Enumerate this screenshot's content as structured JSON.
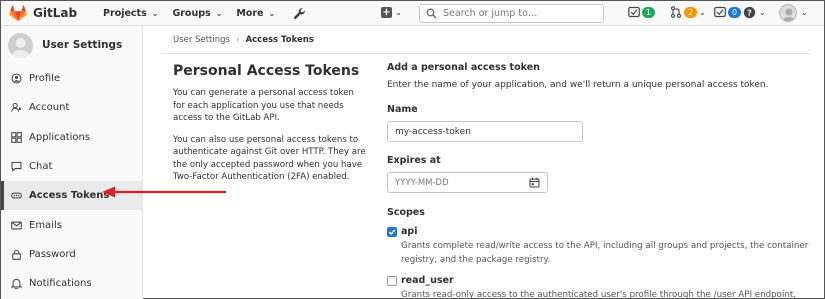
{
  "topbar": {
    "brand": "GitLab",
    "nav": [
      {
        "label": "Projects",
        "icon": "chevron-down-icon"
      },
      {
        "label": "Groups",
        "icon": "chevron-down-icon"
      },
      {
        "label": "More",
        "icon": "chevron-down-icon"
      }
    ],
    "search_placeholder": "Search or jump to…",
    "merge_requests_count": "1",
    "todos_count": "2",
    "issues_count": "0",
    "accent": "#1aaa55"
  },
  "sidebar": {
    "title": "User Settings",
    "items": [
      {
        "label": "Profile",
        "icon": "profile-icon"
      },
      {
        "label": "Account",
        "icon": "account-icon"
      },
      {
        "label": "Applications",
        "icon": "applications-icon"
      },
      {
        "label": "Chat",
        "icon": "chat-icon"
      },
      {
        "label": "Access Tokens",
        "icon": "token-icon",
        "active": true
      },
      {
        "label": "Emails",
        "icon": "email-icon"
      },
      {
        "label": "Password",
        "icon": "lock-icon"
      },
      {
        "label": "Notifications",
        "icon": "bell-icon"
      }
    ]
  },
  "breadcrumb": {
    "parent": "User Settings",
    "current": "Access Tokens"
  },
  "info": {
    "title": "Personal Access Tokens",
    "para1": "You can generate a personal access token for each application you use that needs access to the GitLab API.",
    "para2": "You can also use personal access tokens to authenticate against Git over HTTP. They are the only accepted password when you have Two-Factor Authentication (2FA) enabled."
  },
  "form": {
    "heading": "Add a personal access token",
    "hint": "Enter the name of your application, and we'll return a unique personal access token.",
    "name_label": "Name",
    "name_value": "my-access-token",
    "expires_label": "Expires at",
    "expires_placeholder": "YYYY-MM-DD",
    "scopes_label": "Scopes",
    "scopes": [
      {
        "name": "api",
        "checked": true,
        "desc": "Grants complete read/write access to the API, including all groups and projects, the container registry, and the package registry."
      },
      {
        "name": "read_user",
        "checked": false,
        "desc": "Grants read-only access to the authenticated user's profile through the /user API endpoint,"
      }
    ]
  },
  "annotation_color": "#e02020"
}
